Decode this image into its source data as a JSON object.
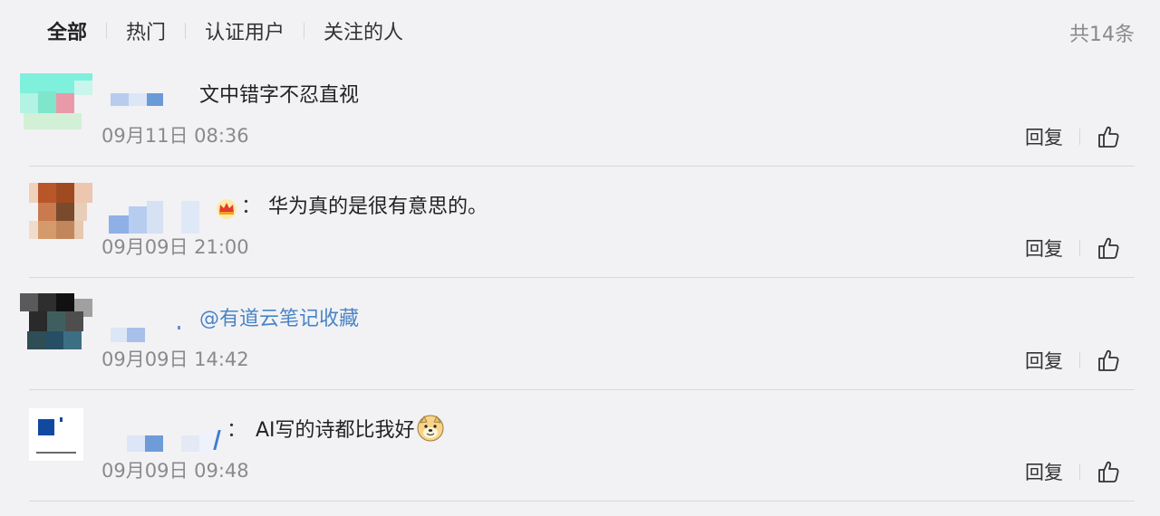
{
  "tabs": [
    {
      "label": "全部",
      "active": true
    },
    {
      "label": "热门",
      "active": false
    },
    {
      "label": "认证用户",
      "active": false
    },
    {
      "label": "关注的人",
      "active": false
    }
  ],
  "total_count": "共14条",
  "reply_label": "回复",
  "comments": [
    {
      "text": "文中错字不忍直视",
      "time": "09月11日 08:36"
    },
    {
      "text": "华为真的是很有意思的。",
      "time": "09月09日 21:00",
      "colon": "："
    },
    {
      "text": "@有道云笔记收藏",
      "time": "09月09日 14:42"
    },
    {
      "text": "AI写的诗都比我好",
      "time": "09月09日 09:48",
      "colon": "："
    }
  ],
  "colors": {
    "background": "#f2f2f5",
    "mention": "#4a84c5",
    "muted": "#8a8a8a"
  },
  "icons": [
    "thumbs-up-icon",
    "crown-icon",
    "doge-emoji-icon"
  ]
}
